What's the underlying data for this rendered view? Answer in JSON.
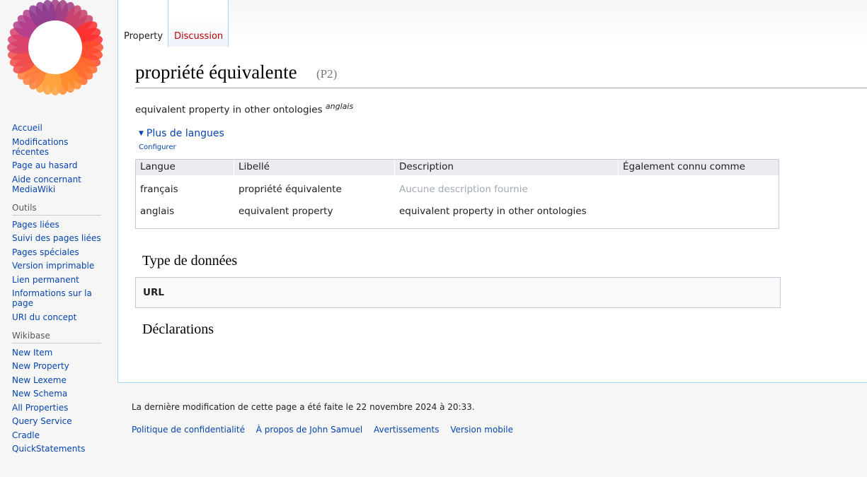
{
  "tabs": {
    "property": "Property",
    "discussion": "Discussion"
  },
  "page": {
    "title": "propriété équivalente",
    "id": "(P2)",
    "description": "equivalent property in other ontologies",
    "description_lang": "anglais"
  },
  "languages": {
    "toggle": "Plus de langues",
    "configure": "Configurer",
    "headers": [
      "Langue",
      "Libellé",
      "Description",
      "Également connu comme"
    ],
    "rows": [
      {
        "lang": "français",
        "label": "propriété équivalente",
        "description": "Aucune description fournie",
        "aliases": ""
      },
      {
        "lang": "anglais",
        "label": "equivalent property",
        "description": "equivalent property in other ontologies",
        "aliases": ""
      }
    ]
  },
  "sections": {
    "datatype_heading": "Type de données",
    "datatype_value": "URL",
    "statements_heading": "Déclarations"
  },
  "sidebar": {
    "navigation": [
      "Accueil",
      "Modifications récentes",
      "Page au hasard",
      "Aide concernant MediaWiki"
    ],
    "tools_heading": "Outils",
    "tools": [
      "Pages liées",
      "Suivi des pages liées",
      "Pages spéciales",
      "Version imprimable",
      "Lien permanent",
      "Informations sur la page",
      "URI du concept"
    ],
    "wikibase_heading": "Wikibase",
    "wikibase": [
      "New Item",
      "New Property",
      "New Lexeme",
      "New Schema",
      "All Properties",
      "Query Service",
      "Cradle",
      "QuickStatements"
    ]
  },
  "footer": {
    "last_modified": "La dernière modification de cette page a été faite le 22 novembre 2024 à 20:33.",
    "links": [
      "Politique de confidentialité",
      "À propos de John Samuel",
      "Avertissements",
      "Version mobile"
    ]
  },
  "colors": {
    "link": "#0645ad",
    "red_link": "#ba0000",
    "muted": "#a2a9b1"
  }
}
